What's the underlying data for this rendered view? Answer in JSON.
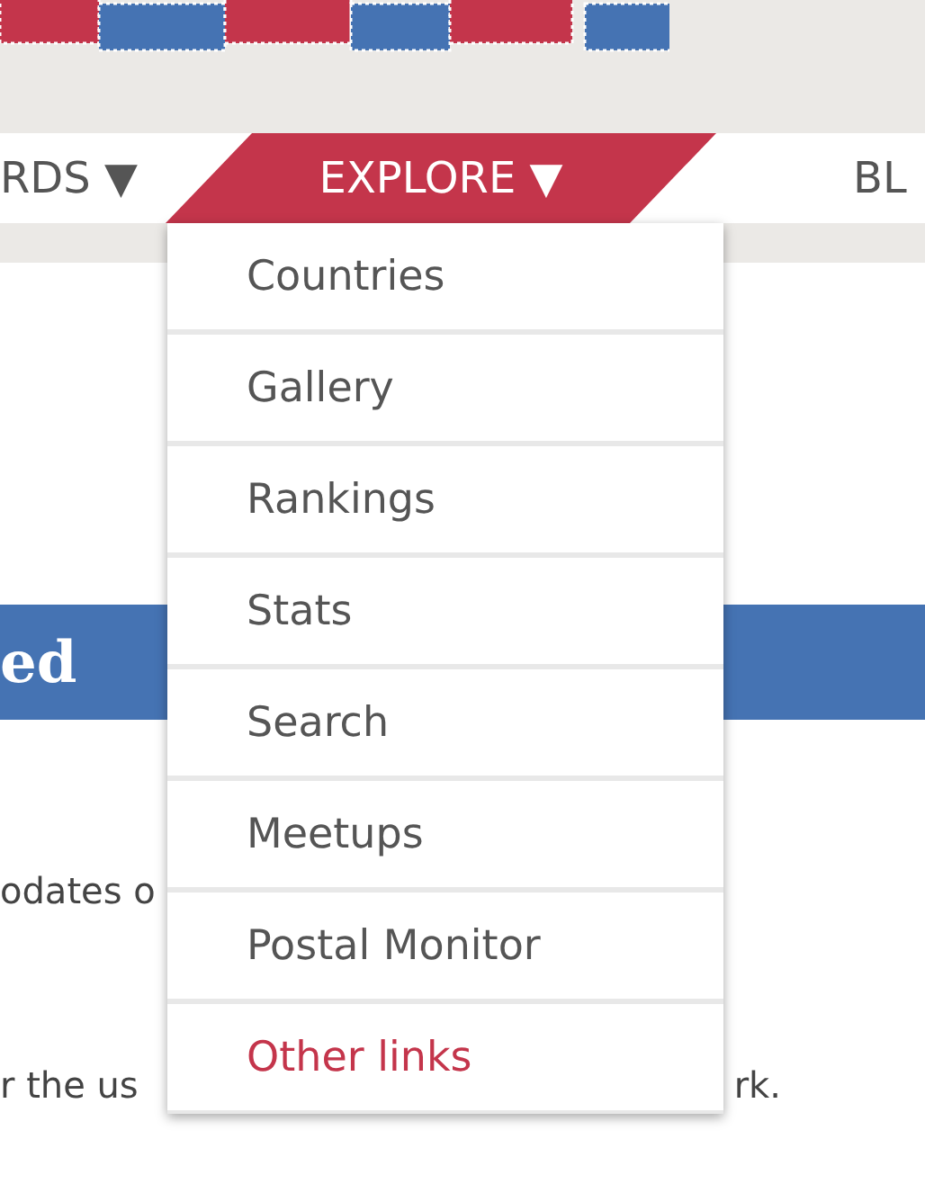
{
  "nav": [
    {
      "label": "RDS ▼",
      "selected": false
    },
    {
      "label": "EXPLORE ▼",
      "selected": true
    },
    {
      "label": "BL",
      "selected": false
    }
  ],
  "banner": {
    "title": "ed"
  },
  "content": [
    {
      "left": "odates o"
    },
    {
      "left": "r the us",
      "right": "rk."
    }
  ],
  "dropdown": [
    {
      "label": "Countries",
      "kind": "item"
    },
    {
      "label": "Gallery",
      "kind": "item"
    },
    {
      "label": "Rankings",
      "kind": "item"
    },
    {
      "label": "Stats",
      "kind": "item"
    },
    {
      "label": "Search",
      "kind": "item"
    },
    {
      "label": "Meetups",
      "kind": "item"
    },
    {
      "label": "Postal Monitor",
      "kind": "item"
    },
    {
      "label": "Other links",
      "kind": "highlight"
    }
  ]
}
